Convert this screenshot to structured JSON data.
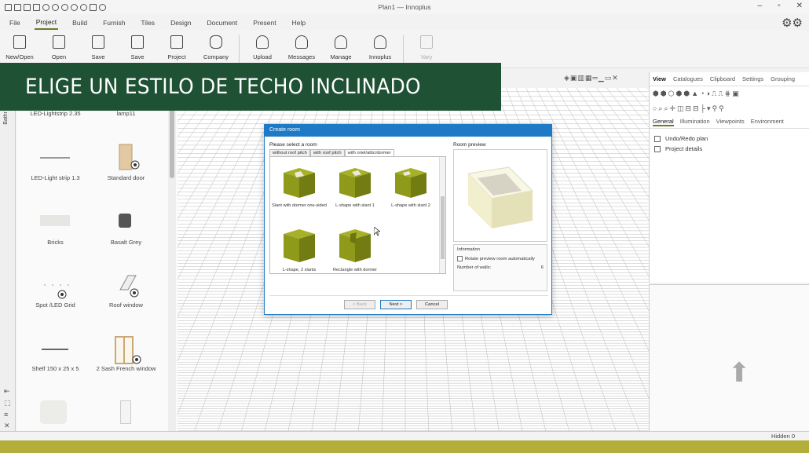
{
  "window": {
    "title": "Plan1 — Innoplus",
    "controls": [
      "–",
      "▫",
      "✕"
    ]
  },
  "menu": {
    "items": [
      "File",
      "Project",
      "Build",
      "Furnish",
      "Tiles",
      "Design",
      "Document",
      "Present",
      "Help"
    ],
    "active": "Project"
  },
  "ribbon": {
    "buttons": [
      "New/Open",
      "Open",
      "Save",
      "Save",
      "Project",
      "Company",
      "Upload",
      "Messages",
      "Manage",
      "Innoplus",
      "Vary"
    ]
  },
  "banner": {
    "text": "ELIGE UN ESTILO DE TECHO INCLINADO",
    "bg": "#1f5235"
  },
  "left_strip": {
    "label": "Bathr"
  },
  "catalog": {
    "items": [
      "LED-Lightstrip 2.35",
      "lamp11",
      "LED-Light strip 1.3",
      "Standard door",
      "Bricks",
      "Basalt Grey",
      "Spot /LED Grid",
      "Roof window",
      "Shelf 150 x 25 x 5",
      "2 Sash French window",
      "",
      ""
    ]
  },
  "right_panel": {
    "tabs": [
      "View",
      "Catalogues",
      "Clipboard",
      "Settings",
      "Grouping"
    ],
    "active_tab": "View",
    "subtabs": [
      "General",
      "Illumination",
      "Viewpoints",
      "Environment"
    ],
    "active_subtab": "General",
    "tree": [
      "Undo/Redo plan",
      "Project details"
    ]
  },
  "status": {
    "hidden": "Hidden 0"
  },
  "dialog": {
    "title": "Create room",
    "prompt": "Please select a room",
    "tabs": [
      "without roof pitch",
      "with roof pitch",
      "with oriel/attic/dormer"
    ],
    "active_tab": "with oriel/attic/dormer",
    "rooms": [
      "Slant with dormer one-sided",
      "L-shape with slant 1",
      "L-shape with slant 2",
      "L-shape, 2 slants",
      "Rectangle with dormer"
    ],
    "preview_label": "Room preview",
    "info_title": "Information",
    "rotate_label": "Rotate preview room automatically",
    "walls_label": "Number of walls:",
    "walls_value": "6",
    "buttons": {
      "back": "< Back",
      "next": "Next >",
      "cancel": "Cancel"
    },
    "accent": "#1e7ac6"
  },
  "colors": {
    "room_green": "#8f9a1a",
    "bottom_bar": "#b3ad3a",
    "accent": "#6b7a2c"
  }
}
